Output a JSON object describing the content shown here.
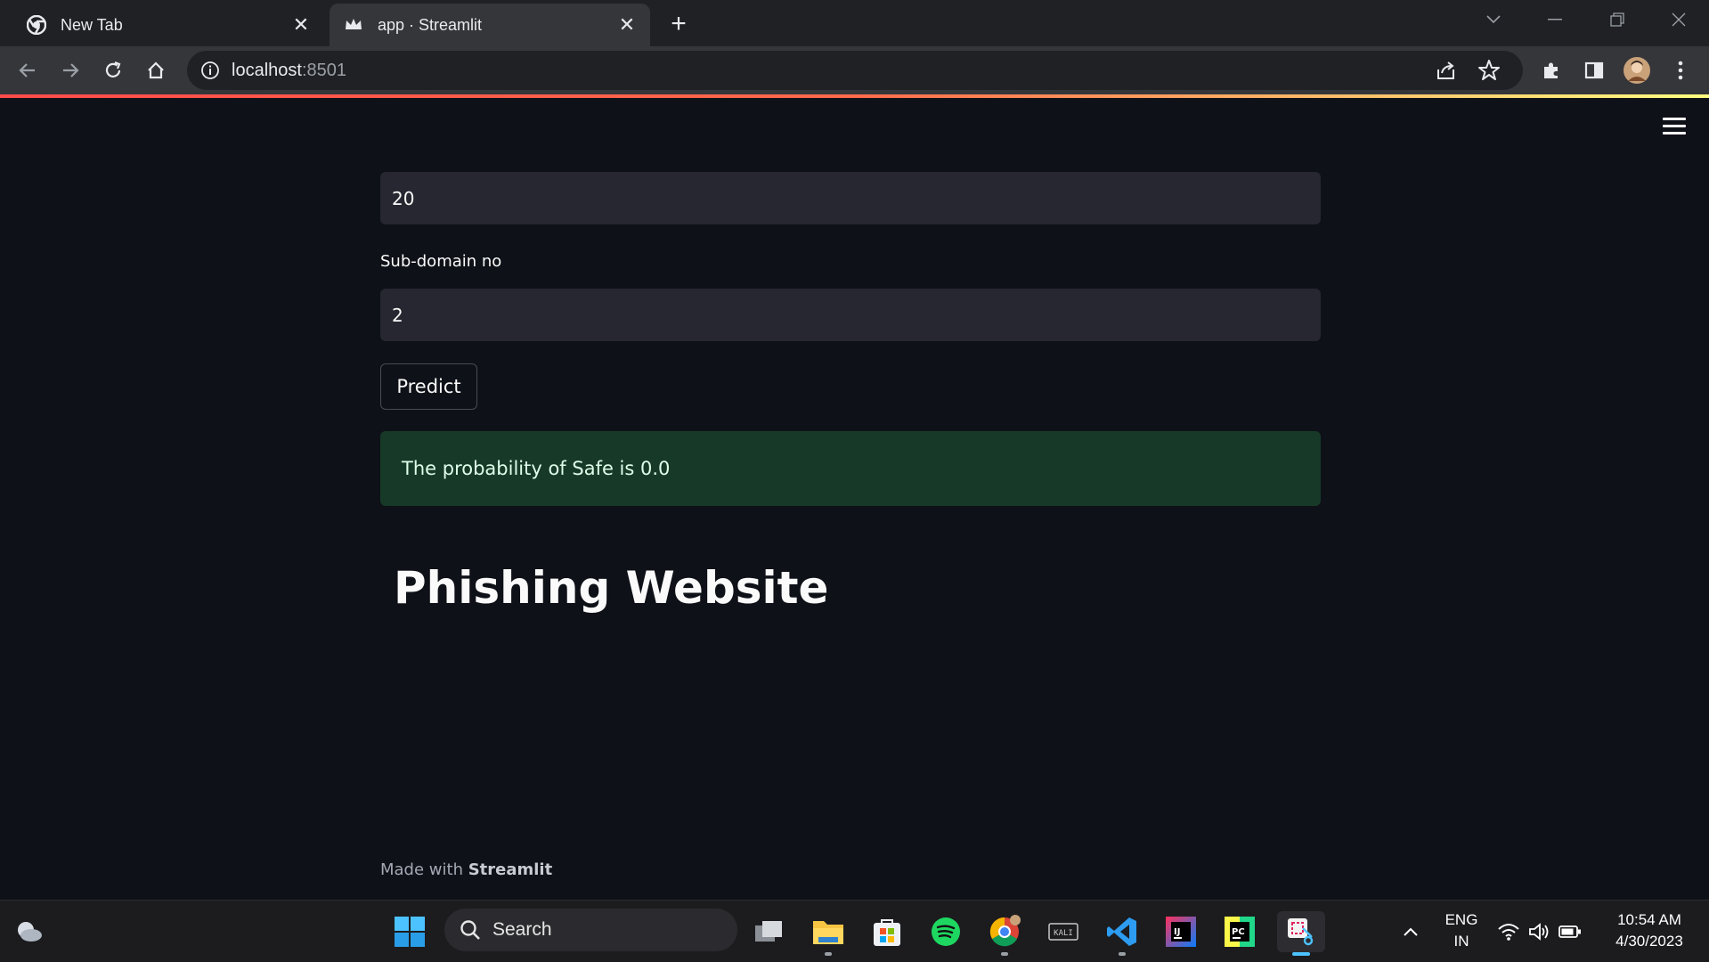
{
  "browser": {
    "tabs": [
      {
        "title": "New Tab",
        "active": false
      },
      {
        "title": "app · Streamlit",
        "active": true
      }
    ],
    "new_tab_symbol": "+",
    "close_symbol": "✕",
    "url_host": "localhost",
    "url_port": ":8501"
  },
  "app": {
    "top_input_value": "20",
    "subdomain_label": "Sub-domain no",
    "subdomain_value": "2",
    "predict_label": "Predict",
    "result_message": "The probability of Safe is 0.0",
    "heading": "Phishing Website",
    "footer_prefix": "Made with ",
    "footer_brand": "Streamlit",
    "alert_color": "#173928",
    "accent_gradient": [
      "#ff4b4b",
      "#fffd80"
    ]
  },
  "taskbar": {
    "search_placeholder": "Search",
    "language_line1": "ENG",
    "language_line2": "IN",
    "time": "10:54 AM",
    "date": "4/30/2023"
  }
}
